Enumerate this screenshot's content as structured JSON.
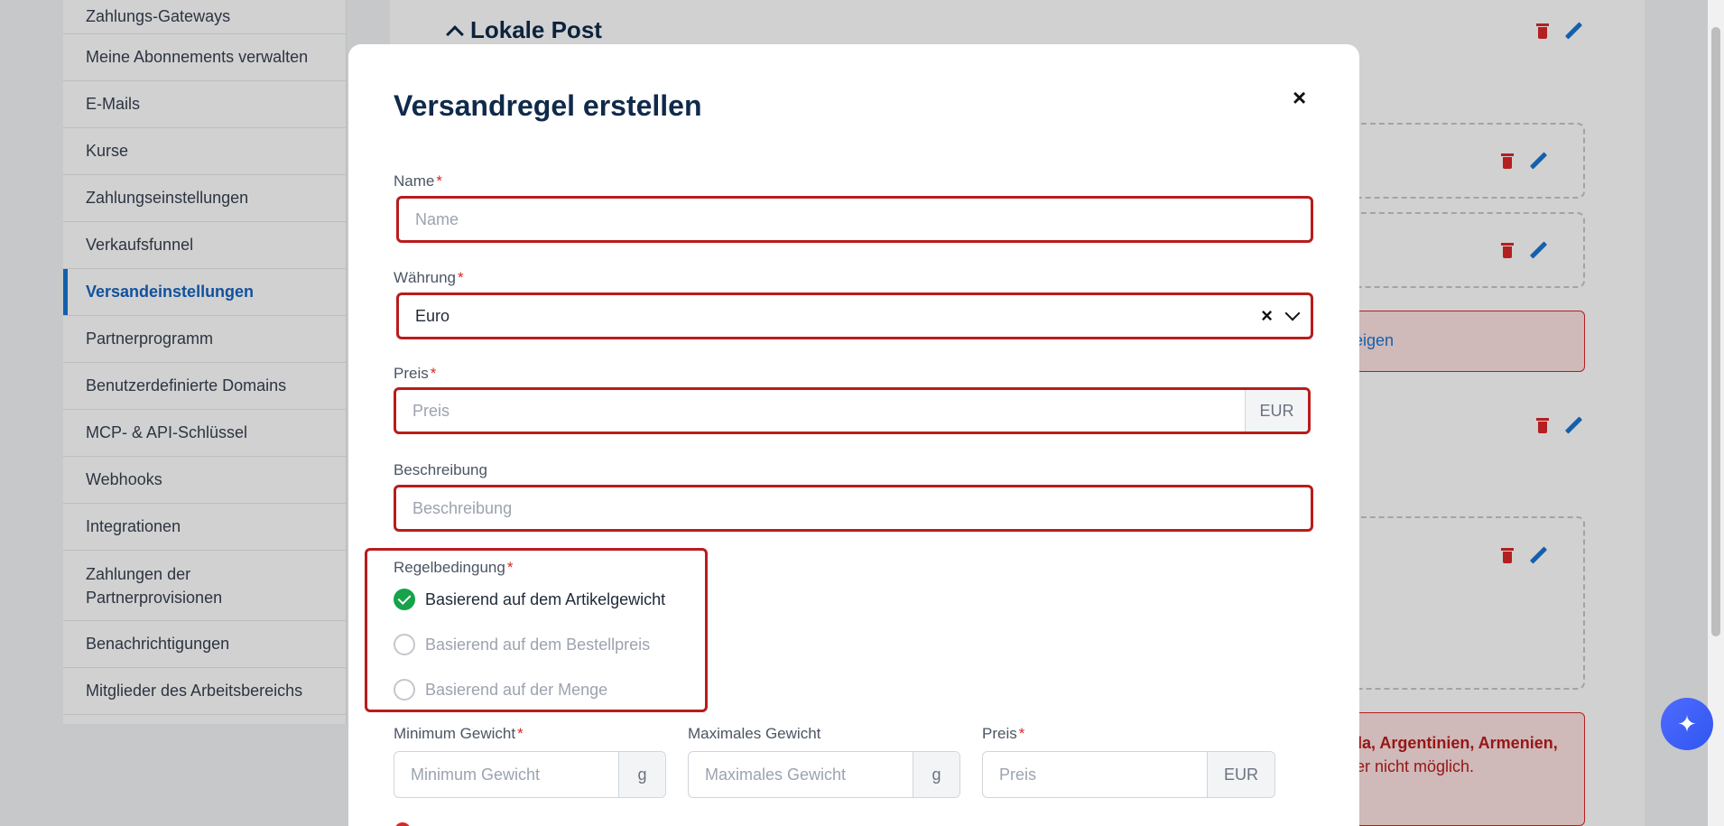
{
  "sidebar": {
    "items": [
      {
        "label": "Zahlungs-Gateways"
      },
      {
        "label": "Meine Abonnements verwalten"
      },
      {
        "label": "E-Mails"
      },
      {
        "label": "Kurse"
      },
      {
        "label": "Zahlungseinstellungen"
      },
      {
        "label": "Verkaufsfunnel"
      },
      {
        "label": "Versandeinstellungen",
        "active": true
      },
      {
        "label": "Partnerprogramm"
      },
      {
        "label": "Benutzerdefinierte Domains"
      },
      {
        "label": "MCP- & API-Schlüssel"
      },
      {
        "label": "Webhooks"
      },
      {
        "label": "Integrationen"
      },
      {
        "label": "Zahlungen der Partnerprovisionen"
      },
      {
        "label": "Benachrichtigungen"
      },
      {
        "label": "Mitglieder des Arbeitsbereichs"
      }
    ]
  },
  "background": {
    "section_title": "Lokale Post",
    "alert_link_fragment": "eigen",
    "alert_countries_fragment": "da, Argentinien, Armenien,",
    "alert_text_fragment": "ler nicht möglich."
  },
  "modal": {
    "title": "Versandregel erstellen",
    "close_label": "×",
    "name": {
      "label": "Name",
      "required_mark": "*",
      "placeholder": "Name"
    },
    "currency": {
      "label": "Währung",
      "required_mark": "*",
      "value": "Euro",
      "clear_icon": "×"
    },
    "price": {
      "label": "Preis",
      "required_mark": "*",
      "placeholder": "Preis",
      "unit": "EUR"
    },
    "description": {
      "label": "Beschreibung",
      "placeholder": "Beschreibung"
    },
    "rule_condition": {
      "label": "Regelbedingung",
      "required_mark": "*",
      "options": [
        {
          "label": "Basierend auf dem Artikelgewicht",
          "checked": true
        },
        {
          "label": "Basierend auf dem Bestellpreis",
          "checked": false
        },
        {
          "label": "Basierend auf der Menge",
          "checked": false
        }
      ]
    },
    "min_weight": {
      "label": "Minimum Gewicht",
      "required_mark": "*",
      "placeholder": "Minimum Gewicht",
      "unit": "g"
    },
    "max_weight": {
      "label": "Maximales Gewicht",
      "placeholder": "Maximales Gewicht",
      "unit": "g"
    },
    "row_price": {
      "label": "Preis",
      "required_mark": "*",
      "placeholder": "Preis",
      "unit": "EUR"
    }
  },
  "colors": {
    "accent": "#1976d2",
    "error_border": "#b91c1c",
    "check": "#16a34a",
    "title": "#0f2a4a"
  },
  "icons": {
    "assistant": "sparkle-icon",
    "delete": "trash-icon",
    "edit": "pencil-icon"
  },
  "assistant_glyph": "✦"
}
